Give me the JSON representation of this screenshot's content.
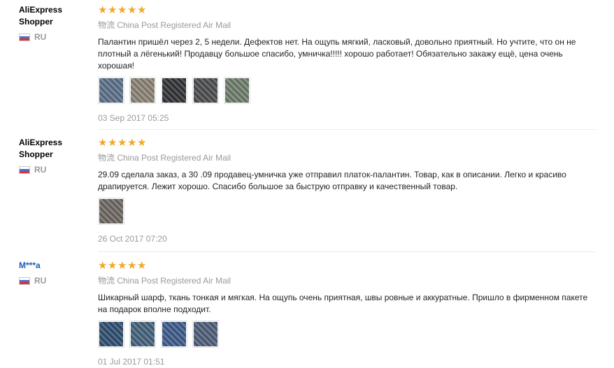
{
  "reviews": [
    {
      "user": "AliExpress Shopper",
      "country": "RU",
      "rating": 5,
      "shipping": "物流 China Post Registered Air Mail",
      "text": "Палантин пришёл через 2, 5 недели. Дефектов нет. На ощупь мягкий, ласковый, довольно приятный. Но учтите, что он не плотный а лёгенький! Продавцу большое спасибо, умничка!!!!! хорошо работает! Обязательно закажу ещё, цена очень хорошая!",
      "photo_colors": [
        "#5a6f87",
        "#8a8273",
        "#2f3134",
        "#4a4c4d",
        "#6d7c6b"
      ],
      "date": "03 Sep 2017 05:25"
    },
    {
      "user": "AliExpress Shopper",
      "country": "RU",
      "rating": 5,
      "shipping": "物流 China Post Registered Air Mail",
      "text": "29.09 сделала заказ, а 30 .09 продавец-умничка уже отправил платок-палантин. Товар, как в описании. Легко и красиво драпируется. Лежит хорошо. Спасибо большое за быструю отправку и качественный товар.",
      "photo_colors": [
        "#6c6760"
      ],
      "date": "26 Oct 2017 07:20"
    },
    {
      "user": "M***a",
      "country": "RU",
      "rating": 5,
      "shipping": "物流 China Post Registered Air Mail",
      "text": "Шикарный шарф, ткань тонкая и мягкая. На ощупь очень приятная, швы ровные и аккуратные. Пришло в фирменном пакете на подарок вполне подходит.",
      "photo_colors": [
        "#2e4d6e",
        "#43617c",
        "#3d5a8a",
        "#4d5d78"
      ],
      "date": "01 Jul 2017 01:51"
    }
  ],
  "ui": {
    "star_glyph": "★",
    "accent_star": "#f5a623",
    "link_color": "#1a5bb8"
  }
}
